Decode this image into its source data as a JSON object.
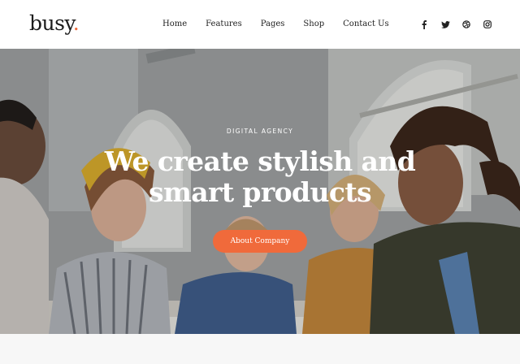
{
  "brand": {
    "name": "busy",
    "dot": ".",
    "accent": "#f06a3b"
  },
  "nav": {
    "items": [
      {
        "label": "Home"
      },
      {
        "label": "Features"
      },
      {
        "label": "Pages"
      },
      {
        "label": "Shop"
      },
      {
        "label": "Contact Us"
      }
    ]
  },
  "social": {
    "icons": [
      "facebook-icon",
      "twitter-icon",
      "dribbble-icon",
      "instagram-icon"
    ]
  },
  "hero": {
    "eyebrow": "DIGITAL AGENCY",
    "headline_line1": "We create stylish and",
    "headline_line2": "smart products",
    "cta_label": "About Company",
    "image": "team-meeting-photo"
  }
}
